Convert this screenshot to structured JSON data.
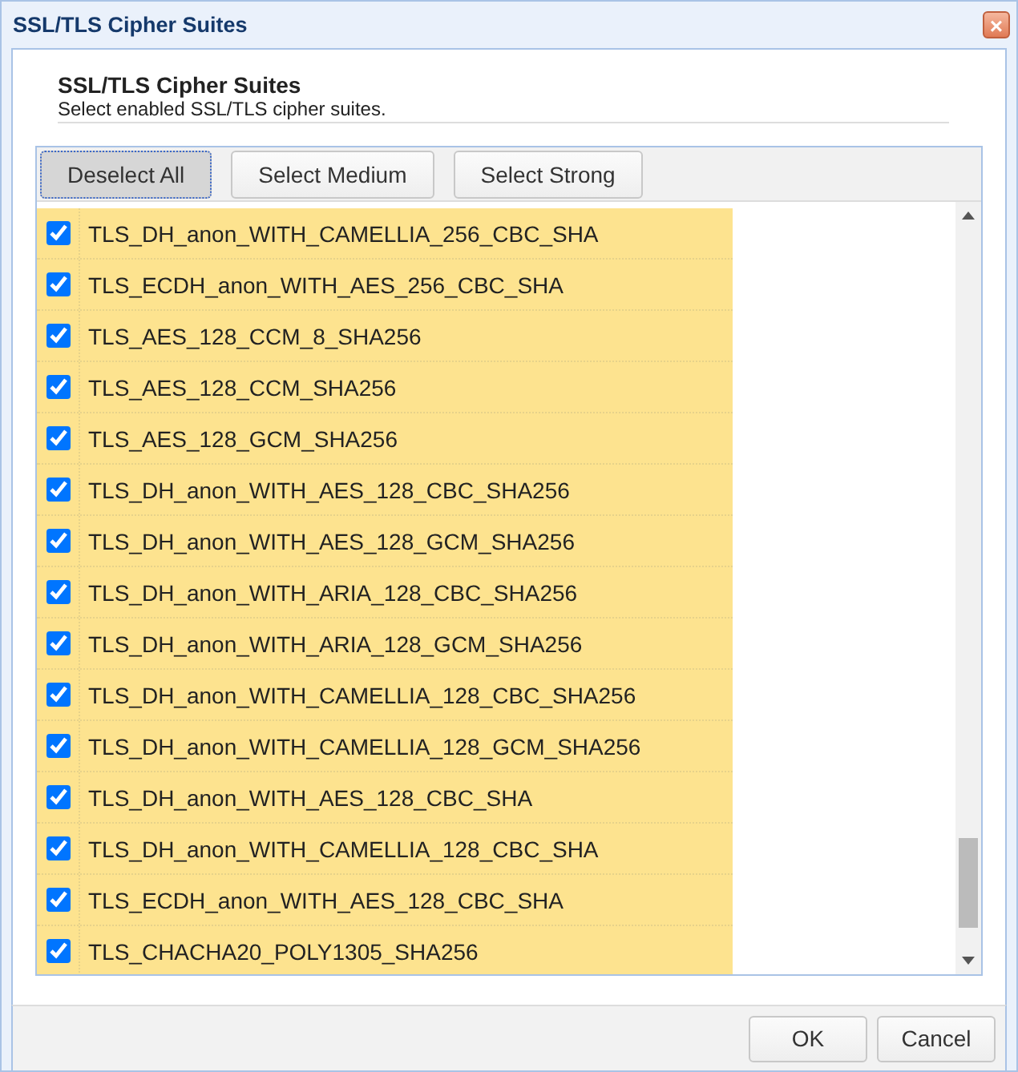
{
  "window": {
    "title": "SSL/TLS Cipher Suites",
    "close": "×"
  },
  "header": {
    "title": "SSL/TLS Cipher Suites",
    "subtitle": "Select enabled SSL/TLS cipher suites."
  },
  "toolbar": [
    {
      "label": "Deselect All",
      "focused": true
    },
    {
      "label": "Select Medium",
      "focused": false
    },
    {
      "label": "Select Strong",
      "focused": false
    }
  ],
  "suites": [
    {
      "name": "TLS_DH_anon_WITH_CAMELLIA_256_CBC_SHA",
      "checked": true
    },
    {
      "name": "TLS_ECDH_anon_WITH_AES_256_CBC_SHA",
      "checked": true
    },
    {
      "name": "TLS_AES_128_CCM_8_SHA256",
      "checked": true
    },
    {
      "name": "TLS_AES_128_CCM_SHA256",
      "checked": true
    },
    {
      "name": "TLS_AES_128_GCM_SHA256",
      "checked": true
    },
    {
      "name": "TLS_DH_anon_WITH_AES_128_CBC_SHA256",
      "checked": true
    },
    {
      "name": "TLS_DH_anon_WITH_AES_128_GCM_SHA256",
      "checked": true
    },
    {
      "name": "TLS_DH_anon_WITH_ARIA_128_CBC_SHA256",
      "checked": true
    },
    {
      "name": "TLS_DH_anon_WITH_ARIA_128_GCM_SHA256",
      "checked": true
    },
    {
      "name": "TLS_DH_anon_WITH_CAMELLIA_128_CBC_SHA256",
      "checked": true
    },
    {
      "name": "TLS_DH_anon_WITH_CAMELLIA_128_GCM_SHA256",
      "checked": true
    },
    {
      "name": "TLS_DH_anon_WITH_AES_128_CBC_SHA",
      "checked": true
    },
    {
      "name": "TLS_DH_anon_WITH_CAMELLIA_128_CBC_SHA",
      "checked": true
    },
    {
      "name": "TLS_ECDH_anon_WITH_AES_128_CBC_SHA",
      "checked": true
    },
    {
      "name": "TLS_CHACHA20_POLY1305_SHA256",
      "checked": true
    }
  ],
  "buttons": [
    "OK",
    "Cancel"
  ]
}
